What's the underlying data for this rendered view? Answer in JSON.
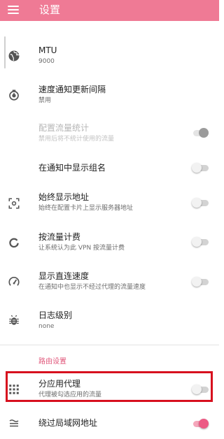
{
  "app_bar": {
    "title": "设置",
    "menu_icon": "menu-icon",
    "background": "#ef7a95"
  },
  "settings": {
    "mtu": {
      "title": "MTU",
      "summary": "9000",
      "icon": "globe-icon"
    },
    "speed_notify": {
      "title": "速度通知更新间隔",
      "summary": "禁用",
      "icon": "timer-icon"
    },
    "traffic_stats": {
      "title": "配置流量统计",
      "summary": "禁用后将不统计使用的流量",
      "enabled": false,
      "checked": true
    },
    "show_group": {
      "title": "在通知中显示组名",
      "checked": false
    },
    "show_address": {
      "title": "始终显示地址",
      "summary": "始终在配置卡片上显示服务器地址",
      "icon": "scan-icon",
      "checked": false
    },
    "metered": {
      "title": "按流量计费",
      "summary": "让系统认为此 VPN 按流量计费",
      "icon": "refresh-circle-icon",
      "checked": false
    },
    "direct_speed": {
      "title": "显示直连速度",
      "summary": "在通知中也显示不经过代理的流量速度",
      "icon": "speedometer-icon",
      "checked": false
    },
    "log_level": {
      "title": "日志级别",
      "summary": "none",
      "icon": "bug-icon"
    }
  },
  "route_category": {
    "label": "路由设置"
  },
  "route": {
    "per_app": {
      "title": "分应用代理",
      "summary": "代理被勾选应用的流量",
      "icon": "apps-grid-icon",
      "checked": false,
      "highlighted": true
    },
    "bypass_lan": {
      "title": "绕过局域网地址",
      "icon": "lan-icon",
      "checked": true
    }
  },
  "colors": {
    "accent": "#ec5a84",
    "highlight_border": "#d7101e"
  }
}
